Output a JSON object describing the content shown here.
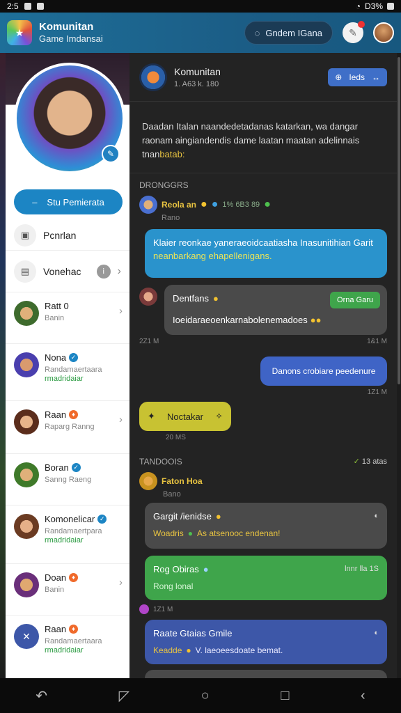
{
  "status": {
    "time": "2:5",
    "battery": "D3%"
  },
  "header": {
    "title": "Komunitan",
    "subtitle": "Game Imdansai",
    "button": "Gndem IGana",
    "button_icon": "chat-icon"
  },
  "sidebar": {
    "action_button": "Stu Pemierata",
    "items": [
      {
        "label": "Pcnrlan"
      },
      {
        "label": "Vonehac"
      }
    ],
    "contacts": [
      {
        "name": "Ratt 0",
        "sub": "Banin",
        "sub2": ""
      },
      {
        "name": "Nona",
        "sub": "Randamaertaara",
        "sub2": "rmadridaiar"
      },
      {
        "name": "Raan",
        "sub": "Raparg Ranng",
        "sub2": ""
      },
      {
        "name": "Boran",
        "sub": "Sanng Raeng",
        "sub2": ""
      },
      {
        "name": "Komonelicar",
        "sub": "Randamaertpara",
        "sub2": "rmadridaiar"
      },
      {
        "name": "Doan",
        "sub": "Banin",
        "sub2": ""
      },
      {
        "name": "Raan",
        "sub": "Randamaertaara",
        "sub2": "rmadridaiar"
      }
    ]
  },
  "group": {
    "title": "Komunitan",
    "meta": "1. A63 k. 180",
    "join_label": "Ieds",
    "description_main": "Daadan Italan naandedetadanas katarkan, wa dangar raonam aingiandendis dame laatan maatan adelinnais",
    "description_end": "tnan",
    "description_highlight": "batab:"
  },
  "section1": "DRONGGRS",
  "messages": {
    "m1": {
      "name": "Reola an",
      "time": "1% 6B3 89",
      "sub": "Rano",
      "text": "Klaier reonkae yaneraeoidcaatiasha Inasunitihian Garit",
      "text_hl": "neanbarkang ehapellenigans."
    },
    "m2": {
      "name": "Dentfans",
      "tag": "Orna Garu",
      "text": "Ioeidaraeoenkarnabolenemadoes"
    },
    "t1": "2Z1 M",
    "t1r": "1&1 M",
    "m3": {
      "text": "Danons crobiare peedenure"
    },
    "t2r": "1Z1 M",
    "m4": {
      "text": "Noctakar"
    },
    "t3": "20 MS"
  },
  "section2": {
    "label": "TANDOOIS",
    "right": "13 atas"
  },
  "messages2": {
    "m5": {
      "name": "Faton Hoa",
      "sub": "Bano"
    },
    "m6": {
      "title": "Gargit /ienidse",
      "sub": "Woadris",
      "sub_rest": "As atsenooc endenan!"
    },
    "m7": {
      "title": "Rog Obiras",
      "sub": "Rong lonal",
      "right": "lnnr lla 1S"
    },
    "t4": "1Z1 M",
    "m8": {
      "title": "Raate Gtaias Gmile",
      "sub": "Keadde",
      "sub_rest": "V. laeoeesdoate bemat."
    }
  },
  "colors": {
    "accent": "#1c85c4",
    "main_bg": "#232323",
    "highlight": "#e9c441",
    "green": "#3fa54b",
    "blue_bubble": "#2a93cc"
  }
}
